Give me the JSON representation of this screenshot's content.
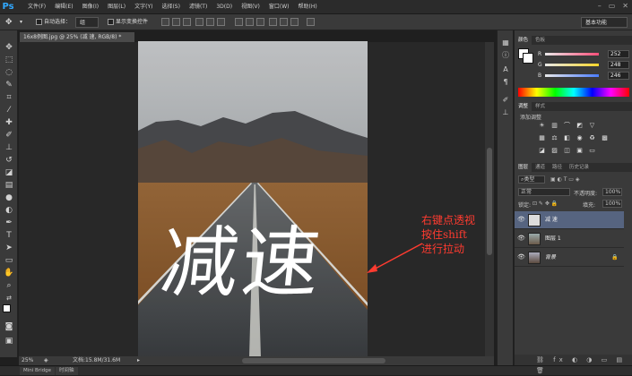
{
  "app": {
    "logo": "Ps"
  },
  "menus": [
    "文件(F)",
    "编辑(E)",
    "图像(I)",
    "图层(L)",
    "文字(Y)",
    "选择(S)",
    "滤镜(T)",
    "3D(D)",
    "视图(V)",
    "窗口(W)",
    "帮助(H)"
  ],
  "window_controls": [
    "–",
    "▭",
    "✕"
  ],
  "options_bar": {
    "auto_select_label": "自动选择：",
    "auto_select_value": "组",
    "show_transform_label": "显示变换控件",
    "workspace": "基本功能"
  },
  "document": {
    "tab_title": "16x8例图.jpg @ 25% (减 速, RGB/8) *",
    "overlay_text": "减速"
  },
  "status": {
    "zoom": "25%",
    "doc_info": "文档:15.8M/31.6M"
  },
  "bottom_tabs": [
    "Mini Bridge",
    "时间轴"
  ],
  "annotation": {
    "line1": "右键点透视",
    "line2": "按住shift",
    "line3": "进行拉动"
  },
  "color_panel": {
    "tabs": [
      "颜色",
      "色板"
    ],
    "r_label": "R",
    "r": "252",
    "g_label": "G",
    "g": "248",
    "b_label": "B",
    "b": "246",
    "accent_r": "#ff4f7a",
    "accent_g": "#f6d52a",
    "accent_b": "#4a7cff"
  },
  "adjust_panel": {
    "tabs": [
      "调整",
      "样式"
    ],
    "title": "添加调整"
  },
  "layers_panel": {
    "tabs": [
      "图层",
      "通道",
      "路径",
      "历史记录"
    ],
    "kind_label": "类型",
    "blend_mode": "正常",
    "opacity_label": "不透明度:",
    "opacity": "100%",
    "lock_label": "锁定:",
    "fill_label": "填充:",
    "fill": "100%",
    "layers": [
      {
        "name": "减 速",
        "selected": true
      },
      {
        "name": "图层 1",
        "selected": false
      },
      {
        "name": "背景",
        "selected": false
      }
    ]
  }
}
